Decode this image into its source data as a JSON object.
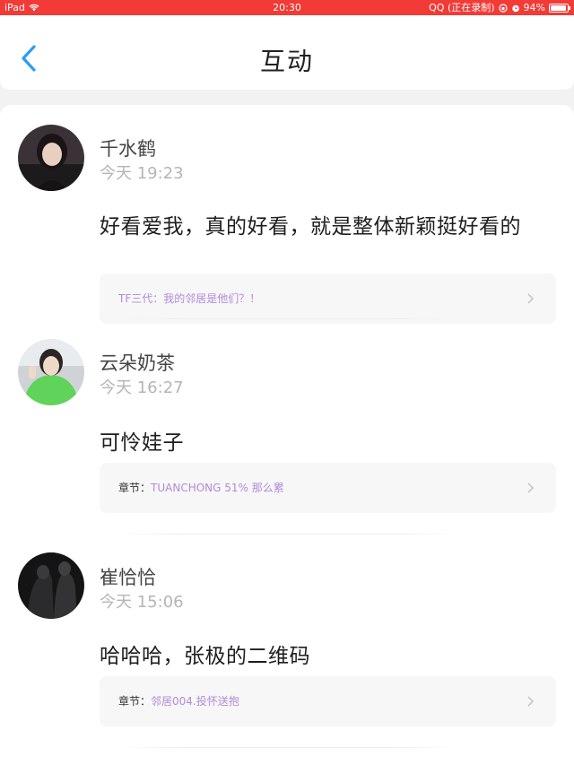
{
  "status_bar": {
    "device": "iPad",
    "time": "20:30",
    "app_status": "QQ (正在录制)",
    "battery_pct": "94%",
    "battery_level": 0.94
  },
  "header": {
    "title": "互动",
    "back_icon": "chevron-left-icon"
  },
  "colors": {
    "status_bar": "#f23a36",
    "accent_blue": "#2a9ef4",
    "reference_purple": "#b28ad6"
  },
  "comments": [
    {
      "user": "千水鹤",
      "time": "今天 19:23",
      "text": "好看爱我，真的好看，就是整体新颖挺好看的",
      "ref_prefix": "",
      "ref_title": "TF三代：我的邻居是他们？！"
    },
    {
      "user": "云朵奶茶",
      "time": "今天 16:27",
      "text": "可怜娃子",
      "ref_prefix": "章节：",
      "ref_title": "TUANCHONG 51% 那么累"
    },
    {
      "user": "崔恰恰",
      "time": "今天 15:06",
      "text": "哈哈哈，张极的二维码",
      "ref_prefix": "章节：",
      "ref_title": "邻居004.投怀送抱"
    }
  ]
}
